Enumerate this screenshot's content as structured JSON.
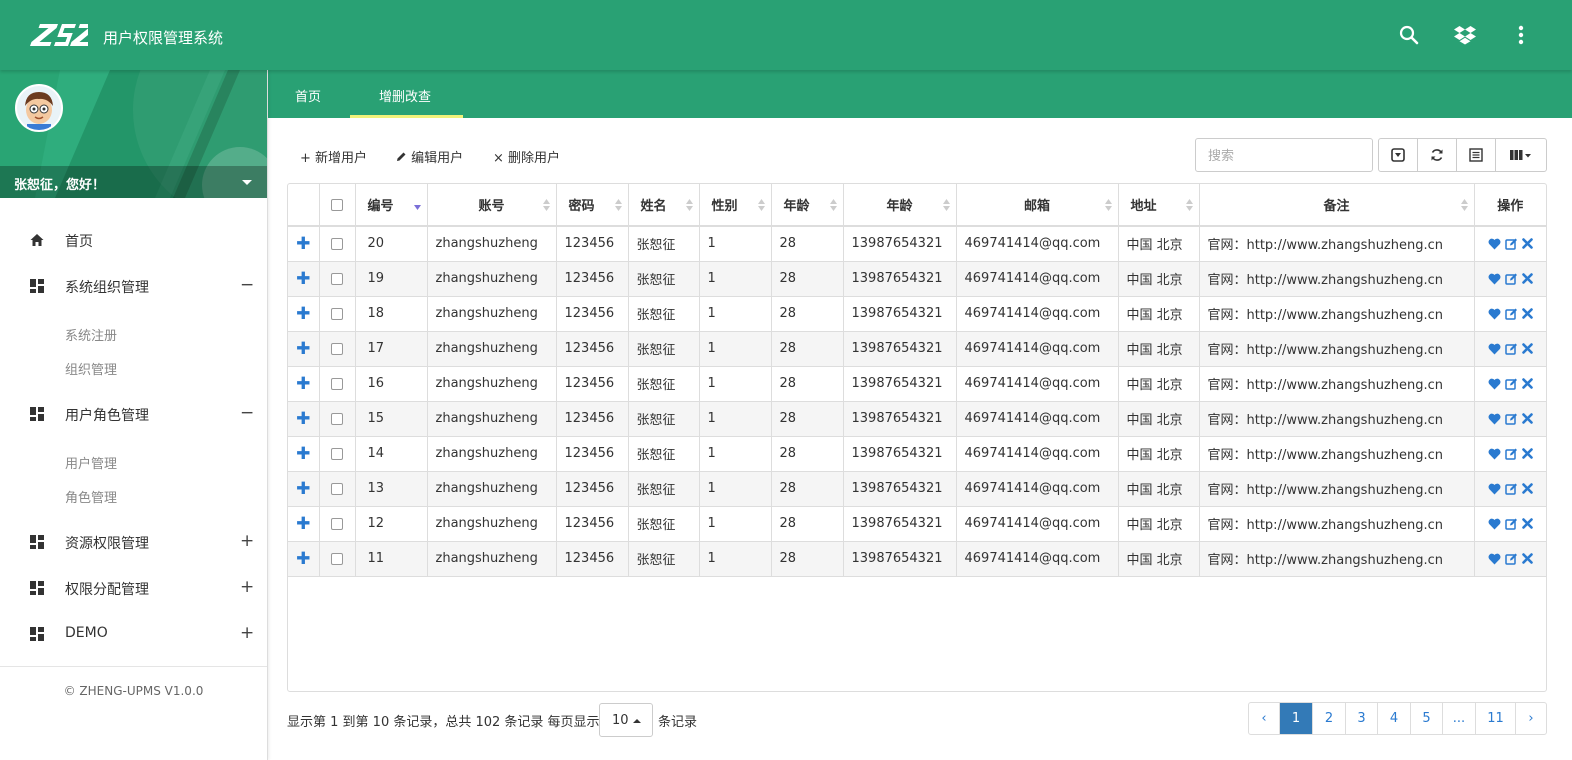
{
  "app": {
    "title": "用户权限管理系统",
    "logo_text": "ZSZ"
  },
  "header_icons": [
    "search-icon",
    "dropbox-icon",
    "more-vert-icon"
  ],
  "profile": {
    "greeting": "张恕征，您好！"
  },
  "sidebar": {
    "items": [
      {
        "label": "首页",
        "icon": "home-icon",
        "toggle": ""
      },
      {
        "label": "系统组织管理",
        "icon": "dashboard-icon",
        "toggle": "−",
        "children": [
          "系统注册",
          "组织管理"
        ]
      },
      {
        "label": "用户角色管理",
        "icon": "dashboard-icon",
        "toggle": "−",
        "children": [
          "用户管理",
          "角色管理"
        ]
      },
      {
        "label": "资源权限管理",
        "icon": "dashboard-icon",
        "toggle": "+"
      },
      {
        "label": "权限分配管理",
        "icon": "dashboard-icon",
        "toggle": "+"
      },
      {
        "label": "DEMO",
        "icon": "dashboard-icon",
        "toggle": "+"
      }
    ],
    "copyright": "© ZHENG-UPMS V1.0.0"
  },
  "tabs": [
    {
      "label": "首页",
      "active": false
    },
    {
      "label": "增删改查",
      "active": true
    }
  ],
  "toolbar": {
    "add_label": "新增用户",
    "edit_label": "编辑用户",
    "delete_label": "删除用户",
    "search_placeholder": "搜索"
  },
  "table": {
    "columns": [
      "编号",
      "账号",
      "密码",
      "姓名",
      "性别",
      "年龄",
      "年龄",
      "邮箱",
      "地址",
      "备注",
      "操作"
    ],
    "rows": [
      {
        "id": "20",
        "account": "zhangshuzheng",
        "password": "123456",
        "name": "张恕征",
        "gender": "1",
        "age": "28",
        "phone": "13987654321",
        "email": "469741414@qq.com",
        "address": "中国 北京",
        "remark": "官网：http://www.zhangshuzheng.cn"
      },
      {
        "id": "19",
        "account": "zhangshuzheng",
        "password": "123456",
        "name": "张恕征",
        "gender": "1",
        "age": "28",
        "phone": "13987654321",
        "email": "469741414@qq.com",
        "address": "中国 北京",
        "remark": "官网：http://www.zhangshuzheng.cn"
      },
      {
        "id": "18",
        "account": "zhangshuzheng",
        "password": "123456",
        "name": "张恕征",
        "gender": "1",
        "age": "28",
        "phone": "13987654321",
        "email": "469741414@qq.com",
        "address": "中国 北京",
        "remark": "官网：http://www.zhangshuzheng.cn"
      },
      {
        "id": "17",
        "account": "zhangshuzheng",
        "password": "123456",
        "name": "张恕征",
        "gender": "1",
        "age": "28",
        "phone": "13987654321",
        "email": "469741414@qq.com",
        "address": "中国 北京",
        "remark": "官网：http://www.zhangshuzheng.cn"
      },
      {
        "id": "16",
        "account": "zhangshuzheng",
        "password": "123456",
        "name": "张恕征",
        "gender": "1",
        "age": "28",
        "phone": "13987654321",
        "email": "469741414@qq.com",
        "address": "中国 北京",
        "remark": "官网：http://www.zhangshuzheng.cn"
      },
      {
        "id": "15",
        "account": "zhangshuzheng",
        "password": "123456",
        "name": "张恕征",
        "gender": "1",
        "age": "28",
        "phone": "13987654321",
        "email": "469741414@qq.com",
        "address": "中国 北京",
        "remark": "官网：http://www.zhangshuzheng.cn"
      },
      {
        "id": "14",
        "account": "zhangshuzheng",
        "password": "123456",
        "name": "张恕征",
        "gender": "1",
        "age": "28",
        "phone": "13987654321",
        "email": "469741414@qq.com",
        "address": "中国 北京",
        "remark": "官网：http://www.zhangshuzheng.cn"
      },
      {
        "id": "13",
        "account": "zhangshuzheng",
        "password": "123456",
        "name": "张恕征",
        "gender": "1",
        "age": "28",
        "phone": "13987654321",
        "email": "469741414@qq.com",
        "address": "中国 北京",
        "remark": "官网：http://www.zhangshuzheng.cn"
      },
      {
        "id": "12",
        "account": "zhangshuzheng",
        "password": "123456",
        "name": "张恕征",
        "gender": "1",
        "age": "28",
        "phone": "13987654321",
        "email": "469741414@qq.com",
        "address": "中国 北京",
        "remark": "官网：http://www.zhangshuzheng.cn"
      },
      {
        "id": "11",
        "account": "zhangshuzheng",
        "password": "123456",
        "name": "张恕征",
        "gender": "1",
        "age": "28",
        "phone": "13987654321",
        "email": "469741414@qq.com",
        "address": "中国 北京",
        "remark": "官网：http://www.zhangshuzheng.cn"
      }
    ]
  },
  "pagination": {
    "info": "显示第 1 到第 10 条记录，总共 102 条记录 每页显示",
    "page_size": "10",
    "records_suffix": "条记录",
    "pages": [
      "‹",
      "1",
      "2",
      "3",
      "4",
      "5",
      "...",
      "11",
      "›"
    ],
    "current": "1"
  },
  "colors": {
    "primary": "#29a174",
    "tab_underline": "#f0f27a",
    "link": "#2a7ad0",
    "active_page": "#337ab7"
  }
}
